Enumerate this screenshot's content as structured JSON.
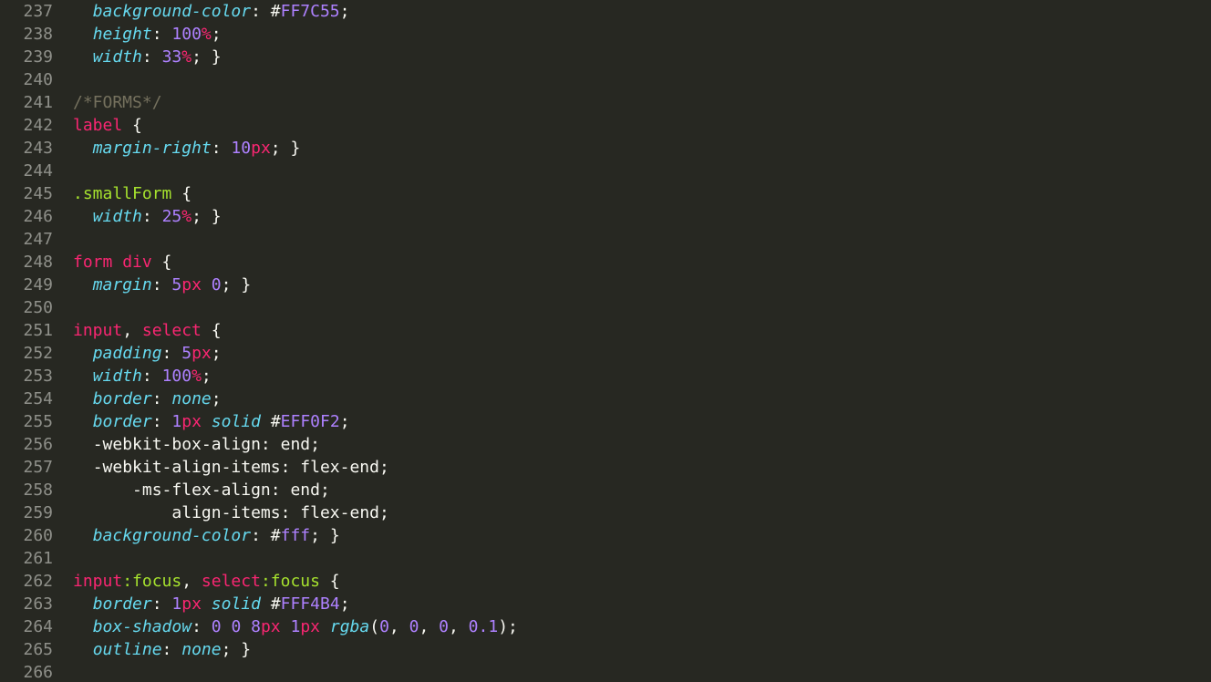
{
  "lines": {
    "l237": {
      "num": "237",
      "prop": "background-color",
      "val_hash": "#",
      "val_hex": "FF7C55"
    },
    "l238": {
      "num": "238",
      "prop": "height",
      "val_num": "100",
      "val_unit": "%"
    },
    "l239": {
      "num": "239",
      "prop": "width",
      "val_num": "33",
      "val_unit": "%"
    },
    "l240": {
      "num": "240"
    },
    "l241": {
      "num": "241",
      "comment": "/*FORMS*/"
    },
    "l242": {
      "num": "242",
      "sel": "label",
      "brace": " {"
    },
    "l243": {
      "num": "243",
      "prop": "margin-right",
      "val_num": "10",
      "val_unit": "px"
    },
    "l244": {
      "num": "244"
    },
    "l245": {
      "num": "245",
      "selclass": ".smallForm",
      "brace": " {"
    },
    "l246": {
      "num": "246",
      "prop": "width",
      "val_num": "25",
      "val_unit": "%"
    },
    "l247": {
      "num": "247"
    },
    "l248": {
      "num": "248",
      "sel1": "form",
      "sel2": "div",
      "brace": " {"
    },
    "l249": {
      "num": "249",
      "prop": "margin",
      "val_num1": "5",
      "val_unit1": "px",
      "val_num2": "0"
    },
    "l250": {
      "num": "250"
    },
    "l251": {
      "num": "251",
      "sel1": "input",
      "sel2": "select",
      "brace": " {"
    },
    "l252": {
      "num": "252",
      "prop": "padding",
      "val_num": "5",
      "val_unit": "px"
    },
    "l253": {
      "num": "253",
      "prop": "width",
      "val_num": "100",
      "val_unit": "%"
    },
    "l254": {
      "num": "254",
      "prop": "border",
      "kw": "none"
    },
    "l255": {
      "num": "255",
      "prop": "border",
      "val_num": "1",
      "val_unit": "px",
      "kw": "solid",
      "hash": "#",
      "hex": "EFF0F2"
    },
    "l256": {
      "num": "256",
      "vprop": "-webkit-box-align",
      "kw": "end"
    },
    "l257": {
      "num": "257",
      "vprop": "-webkit-align-items",
      "kw": "flex-end"
    },
    "l258": {
      "num": "258",
      "vprop": "-ms-flex-align",
      "kw": "end"
    },
    "l259": {
      "num": "259",
      "vprop": "align-items",
      "kw": "flex-end"
    },
    "l260": {
      "num": "260",
      "prop": "background-color",
      "hash": "#",
      "hex": "fff"
    },
    "l261": {
      "num": "261"
    },
    "l262": {
      "num": "262",
      "sel1": "input",
      "pseudo1": ":focus",
      "sel2": "select",
      "pseudo2": ":focus",
      "brace": " {"
    },
    "l263": {
      "num": "263",
      "prop": "border",
      "val_num": "1",
      "val_unit": "px",
      "kw": "solid",
      "hash": "#",
      "hex": "FFF4B4"
    },
    "l264": {
      "num": "264",
      "prop": "box-shadow",
      "n0": "0",
      "n1": "0",
      "n2": "8",
      "u2": "px",
      "n3": "1",
      "u3": "px",
      "func": "rgba",
      "a0": "0",
      "a1": "0",
      "a2": "0",
      "a3": "0.1"
    },
    "l265": {
      "num": "265",
      "prop": "outline",
      "kw": "none"
    },
    "l266": {
      "num": "266"
    }
  }
}
